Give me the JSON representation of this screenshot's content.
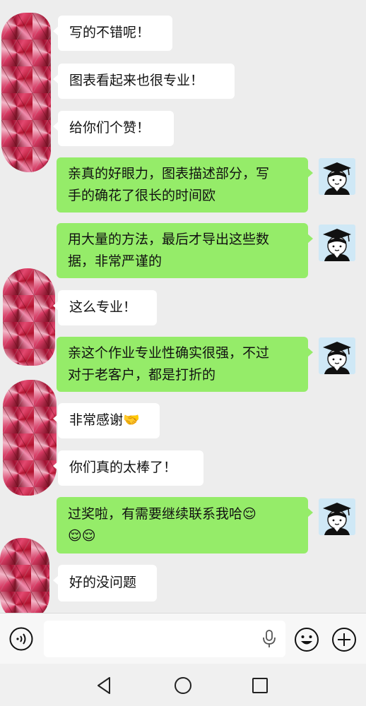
{
  "messages": [
    {
      "side": "in",
      "text": "写的不错呢！"
    },
    {
      "side": "in",
      "text": "图表看起来也很专业！"
    },
    {
      "side": "in",
      "text": "给你们个赞！"
    },
    {
      "side": "out",
      "text": "亲真的好眼力，图表描述部分，写\n手的确花了很长的时间欧"
    },
    {
      "side": "out",
      "text": "用大量的方法，最后才导出这些数\n据，非常严谨的"
    },
    {
      "side": "in",
      "text": "这么专业！"
    },
    {
      "side": "out",
      "text": "亲这个作业专业性确实很强，不过\n对于老客户，都是打折的"
    },
    {
      "side": "in",
      "text": "非常感谢🤝"
    },
    {
      "side": "in",
      "text": "你们真的太棒了！"
    },
    {
      "side": "out",
      "text": "过奖啦，有需要继续联系我哈😌\n😌😌"
    },
    {
      "side": "in",
      "text": "好的没问题"
    }
  ],
  "input": {
    "value": "",
    "placeholder": ""
  },
  "icons": {
    "voice": "voice-icon",
    "mic": "microphone-icon",
    "emoji": "emoji-icon",
    "plus": "plus-icon",
    "back": "back-icon",
    "home": "home-icon",
    "recents": "recents-icon"
  },
  "colors": {
    "incoming": "#ffffff",
    "outgoing": "#95ec69",
    "background": "#ededed"
  }
}
